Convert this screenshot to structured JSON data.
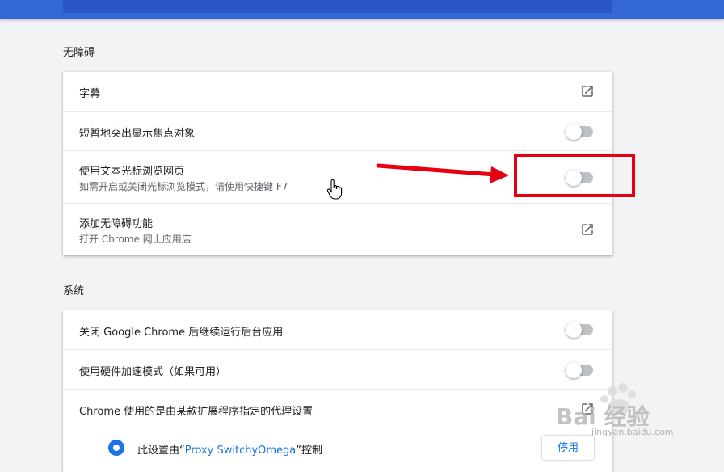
{
  "sections": {
    "accessibility": {
      "title": "无障碍",
      "rows": {
        "captions": {
          "label": "字幕"
        },
        "focus_highlight": {
          "label": "短暂地突出显示焦点对象",
          "enabled": false
        },
        "caret_browsing": {
          "label": "使用文本光标浏览网页",
          "sublabel": "如需开启或关闭光标浏览模式，请使用快捷键 F7",
          "enabled": false
        },
        "add_features": {
          "label": "添加无障碍功能",
          "sublabel": "打开 Chrome 网上应用店"
        }
      }
    },
    "system": {
      "title": "系统",
      "rows": {
        "background_apps": {
          "label": "关闭 Google Chrome 后继续运行后台应用",
          "enabled": false
        },
        "hardware_accel": {
          "label": "使用硬件加速模式（如果可用）",
          "enabled": false
        },
        "proxy": {
          "label": "Chrome 使用的是由某款扩展程序指定的代理设置"
        },
        "proxy_control": {
          "prefix": "此设置由“",
          "extension": "Proxy SwitchyOmega",
          "suffix": "”控制",
          "button": "停用"
        }
      }
    }
  },
  "watermark": {
    "text": "Bai 经验",
    "url": "jingyan.baidu.com"
  },
  "colors": {
    "accent": "#1a73e8",
    "header": "#3367d6",
    "annotation": "#e60012",
    "toggle_off": "#bdc1c6"
  }
}
